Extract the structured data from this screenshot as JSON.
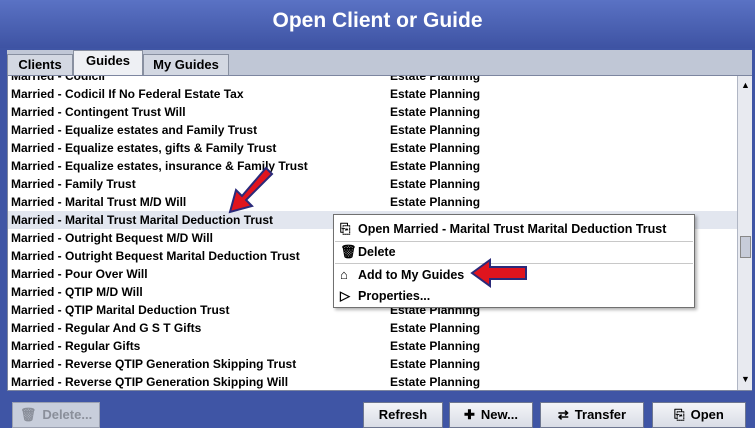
{
  "window": {
    "title": "Open Client or Guide"
  },
  "tabs": [
    {
      "label": "Clients"
    },
    {
      "label": "Guides"
    },
    {
      "label": "My Guides"
    }
  ],
  "list": {
    "partial_top_row": {
      "name": "Married - Codicil",
      "type": "Estate Planning"
    },
    "rows": [
      {
        "name": "Married - Codicil If No Federal Estate Tax",
        "type": "Estate Planning"
      },
      {
        "name": "Married - Contingent Trust Will",
        "type": "Estate Planning"
      },
      {
        "name": "Married - Equalize estates and Family Trust",
        "type": "Estate Planning"
      },
      {
        "name": "Married - Equalize estates, gifts & Family Trust",
        "type": "Estate Planning"
      },
      {
        "name": "Married - Equalize estates, insurance & Family Trust",
        "type": "Estate Planning"
      },
      {
        "name": "Married - Family Trust",
        "type": "Estate Planning"
      },
      {
        "name": "Married - Marital Trust M/D Will",
        "type": "Estate Planning"
      },
      {
        "name": "Married - Marital Trust Marital Deduction Trust",
        "type": ""
      },
      {
        "name": "Married - Outright Bequest M/D Will",
        "type": ""
      },
      {
        "name": "Married - Outright Bequest Marital Deduction Trust",
        "type": ""
      },
      {
        "name": "Married - Pour Over Will",
        "type": ""
      },
      {
        "name": "Married - QTIP M/D Will",
        "type": ""
      },
      {
        "name": "Married - QTIP Marital Deduction Trust",
        "type": "Estate Planning"
      },
      {
        "name": "Married - Regular And G S T Gifts",
        "type": "Estate Planning"
      },
      {
        "name": "Married - Regular Gifts",
        "type": "Estate Planning"
      },
      {
        "name": "Married - Reverse QTIP Generation Skipping Trust",
        "type": "Estate Planning"
      },
      {
        "name": "Married - Reverse QTIP Generation Skipping Will",
        "type": "Estate Planning"
      }
    ]
  },
  "context_menu": {
    "open_label": "Open Married - Marital Trust Marital Deduction Trust",
    "delete_label": "Delete",
    "add_label": "Add to My Guides",
    "properties_label": "Properties..."
  },
  "buttons": {
    "delete": "Delete...",
    "refresh": "Refresh",
    "new": "New...",
    "transfer": "Transfer",
    "open": "Open"
  },
  "icons": {
    "scroll_up": "scroll-up-arrow-icon",
    "scroll_down": "scroll-down-arrow-icon"
  },
  "colors": {
    "window_blue": "#3f55a5",
    "annotation_arrow": "#e0141e"
  }
}
